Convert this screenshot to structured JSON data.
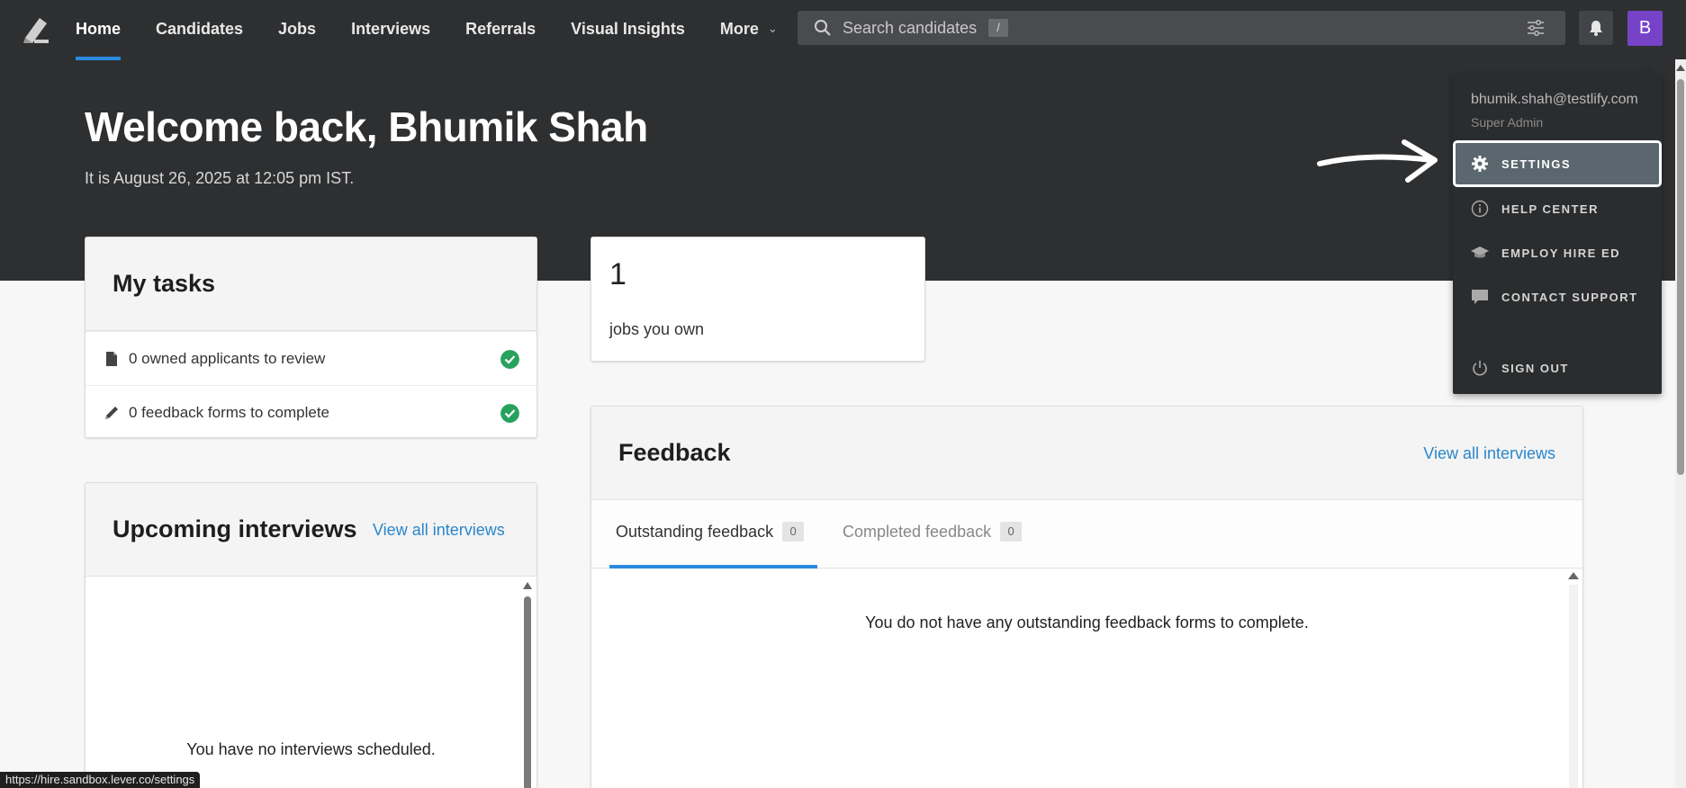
{
  "nav": {
    "items": [
      {
        "label": "Home",
        "active": true
      },
      {
        "label": "Candidates"
      },
      {
        "label": "Jobs"
      },
      {
        "label": "Interviews"
      },
      {
        "label": "Referrals"
      },
      {
        "label": "Visual Insights"
      },
      {
        "label": "More"
      }
    ],
    "search_placeholder": "Search candidates",
    "search_shortcut": "/",
    "avatar_initial": "B",
    "accent_color": "#2a8ae0",
    "avatar_color": "#7643c8"
  },
  "hero": {
    "welcome": "Welcome back, Bhumik Shah",
    "date_line": "It is August 26, 2025 at 12:05 pm IST."
  },
  "tasks": {
    "title": "My tasks",
    "items": [
      {
        "label": "0 owned applicants to review",
        "icon": "document-icon",
        "done": true
      },
      {
        "label": "0 feedback forms to complete",
        "icon": "pencil-icon",
        "done": true
      }
    ]
  },
  "jobs_owned": {
    "count": "1",
    "label": "jobs you own"
  },
  "upcoming": {
    "title": "Upcoming interviews",
    "link": "View all interviews",
    "empty": "You have no interviews scheduled."
  },
  "feedback": {
    "title": "Feedback",
    "link": "View all interviews",
    "tabs": [
      {
        "label": "Outstanding feedback",
        "count": "0",
        "active": true
      },
      {
        "label": "Completed feedback",
        "count": "0",
        "active": false
      }
    ],
    "empty": "You do not have any outstanding feedback forms to complete."
  },
  "dropdown": {
    "email": "bhumik.shah@testlify.com",
    "role": "Super Admin",
    "items": [
      {
        "label": "SETTINGS",
        "icon": "gear-icon",
        "highlighted": true
      },
      {
        "label": "HELP CENTER",
        "icon": "info-icon"
      },
      {
        "label": "EMPLOY HIRE ED",
        "icon": "graduation-cap-icon"
      },
      {
        "label": "CONTACT SUPPORT",
        "icon": "chat-bubble-icon"
      },
      {
        "label": "SIGN OUT",
        "icon": "power-icon"
      }
    ]
  },
  "status_url": "https://hire.sandbox.lever.co/settings"
}
